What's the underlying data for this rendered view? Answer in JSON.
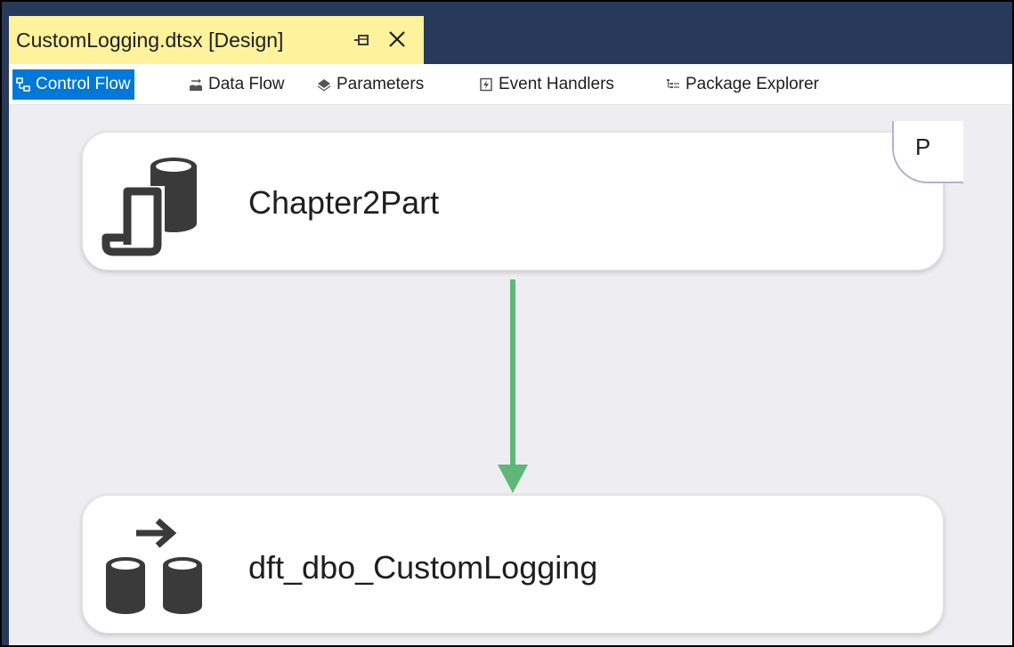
{
  "window": {
    "tab_title": "CustomLogging.dtsx [Design]"
  },
  "toolbar": {
    "items": [
      {
        "label": "Control Flow",
        "icon": "control-flow-icon",
        "active": true
      },
      {
        "label": "Data Flow",
        "icon": "data-flow-icon",
        "active": false
      },
      {
        "label": "Parameters",
        "icon": "parameters-icon",
        "active": false
      },
      {
        "label": "Event Handlers",
        "icon": "event-handlers-icon",
        "active": false
      },
      {
        "label": "Package Explorer",
        "icon": "package-explorer-icon",
        "active": false
      }
    ]
  },
  "canvas": {
    "tasks": [
      {
        "label": "Chapter2Part",
        "icon": "execute-package-task-icon"
      },
      {
        "label": "dft_dbo_CustomLogging",
        "icon": "data-flow-task-icon"
      }
    ],
    "precedence_constraint": {
      "type": "success",
      "color": "#5fb878"
    },
    "badge": "P"
  },
  "colors": {
    "ide_background": "#283a59",
    "active_tab": "#fff29d",
    "accent": "#0078d7",
    "canvas": "#eeeef2"
  }
}
